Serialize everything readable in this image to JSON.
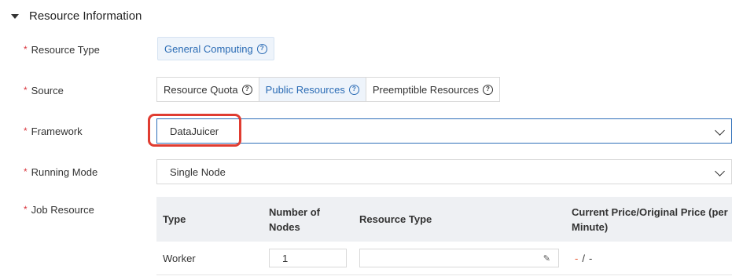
{
  "section": {
    "title": "Resource Information"
  },
  "fields": {
    "resource_type": {
      "label": "Resource Type",
      "value": "General Computing"
    },
    "source": {
      "label": "Source",
      "options": [
        "Resource Quota",
        "Public Resources",
        "Preemptible Resources"
      ],
      "selected": "Public Resources"
    },
    "framework": {
      "label": "Framework",
      "value": "DataJuicer"
    },
    "running_mode": {
      "label": "Running Mode",
      "value": "Single Node"
    },
    "job_resource": {
      "label": "Job Resource"
    }
  },
  "table": {
    "headers": [
      "Type",
      "Number of Nodes",
      "Resource Type",
      "Current Price/Original Price (per Minute)"
    ],
    "rows": [
      {
        "type": "Worker",
        "nodes": "1",
        "resource_type": "",
        "price_current": "-",
        "price_sep": "/",
        "price_original": "-"
      }
    ]
  },
  "colors": {
    "accent": "#2b6cb5",
    "required": "#d9363e",
    "highlight": "#e03c31",
    "price_dash": "#e6562e"
  },
  "icons": {
    "collapse": "caret-down-icon",
    "help": "question-circle-icon",
    "select": "chevron-down-icon",
    "edit": "pencil-icon"
  }
}
